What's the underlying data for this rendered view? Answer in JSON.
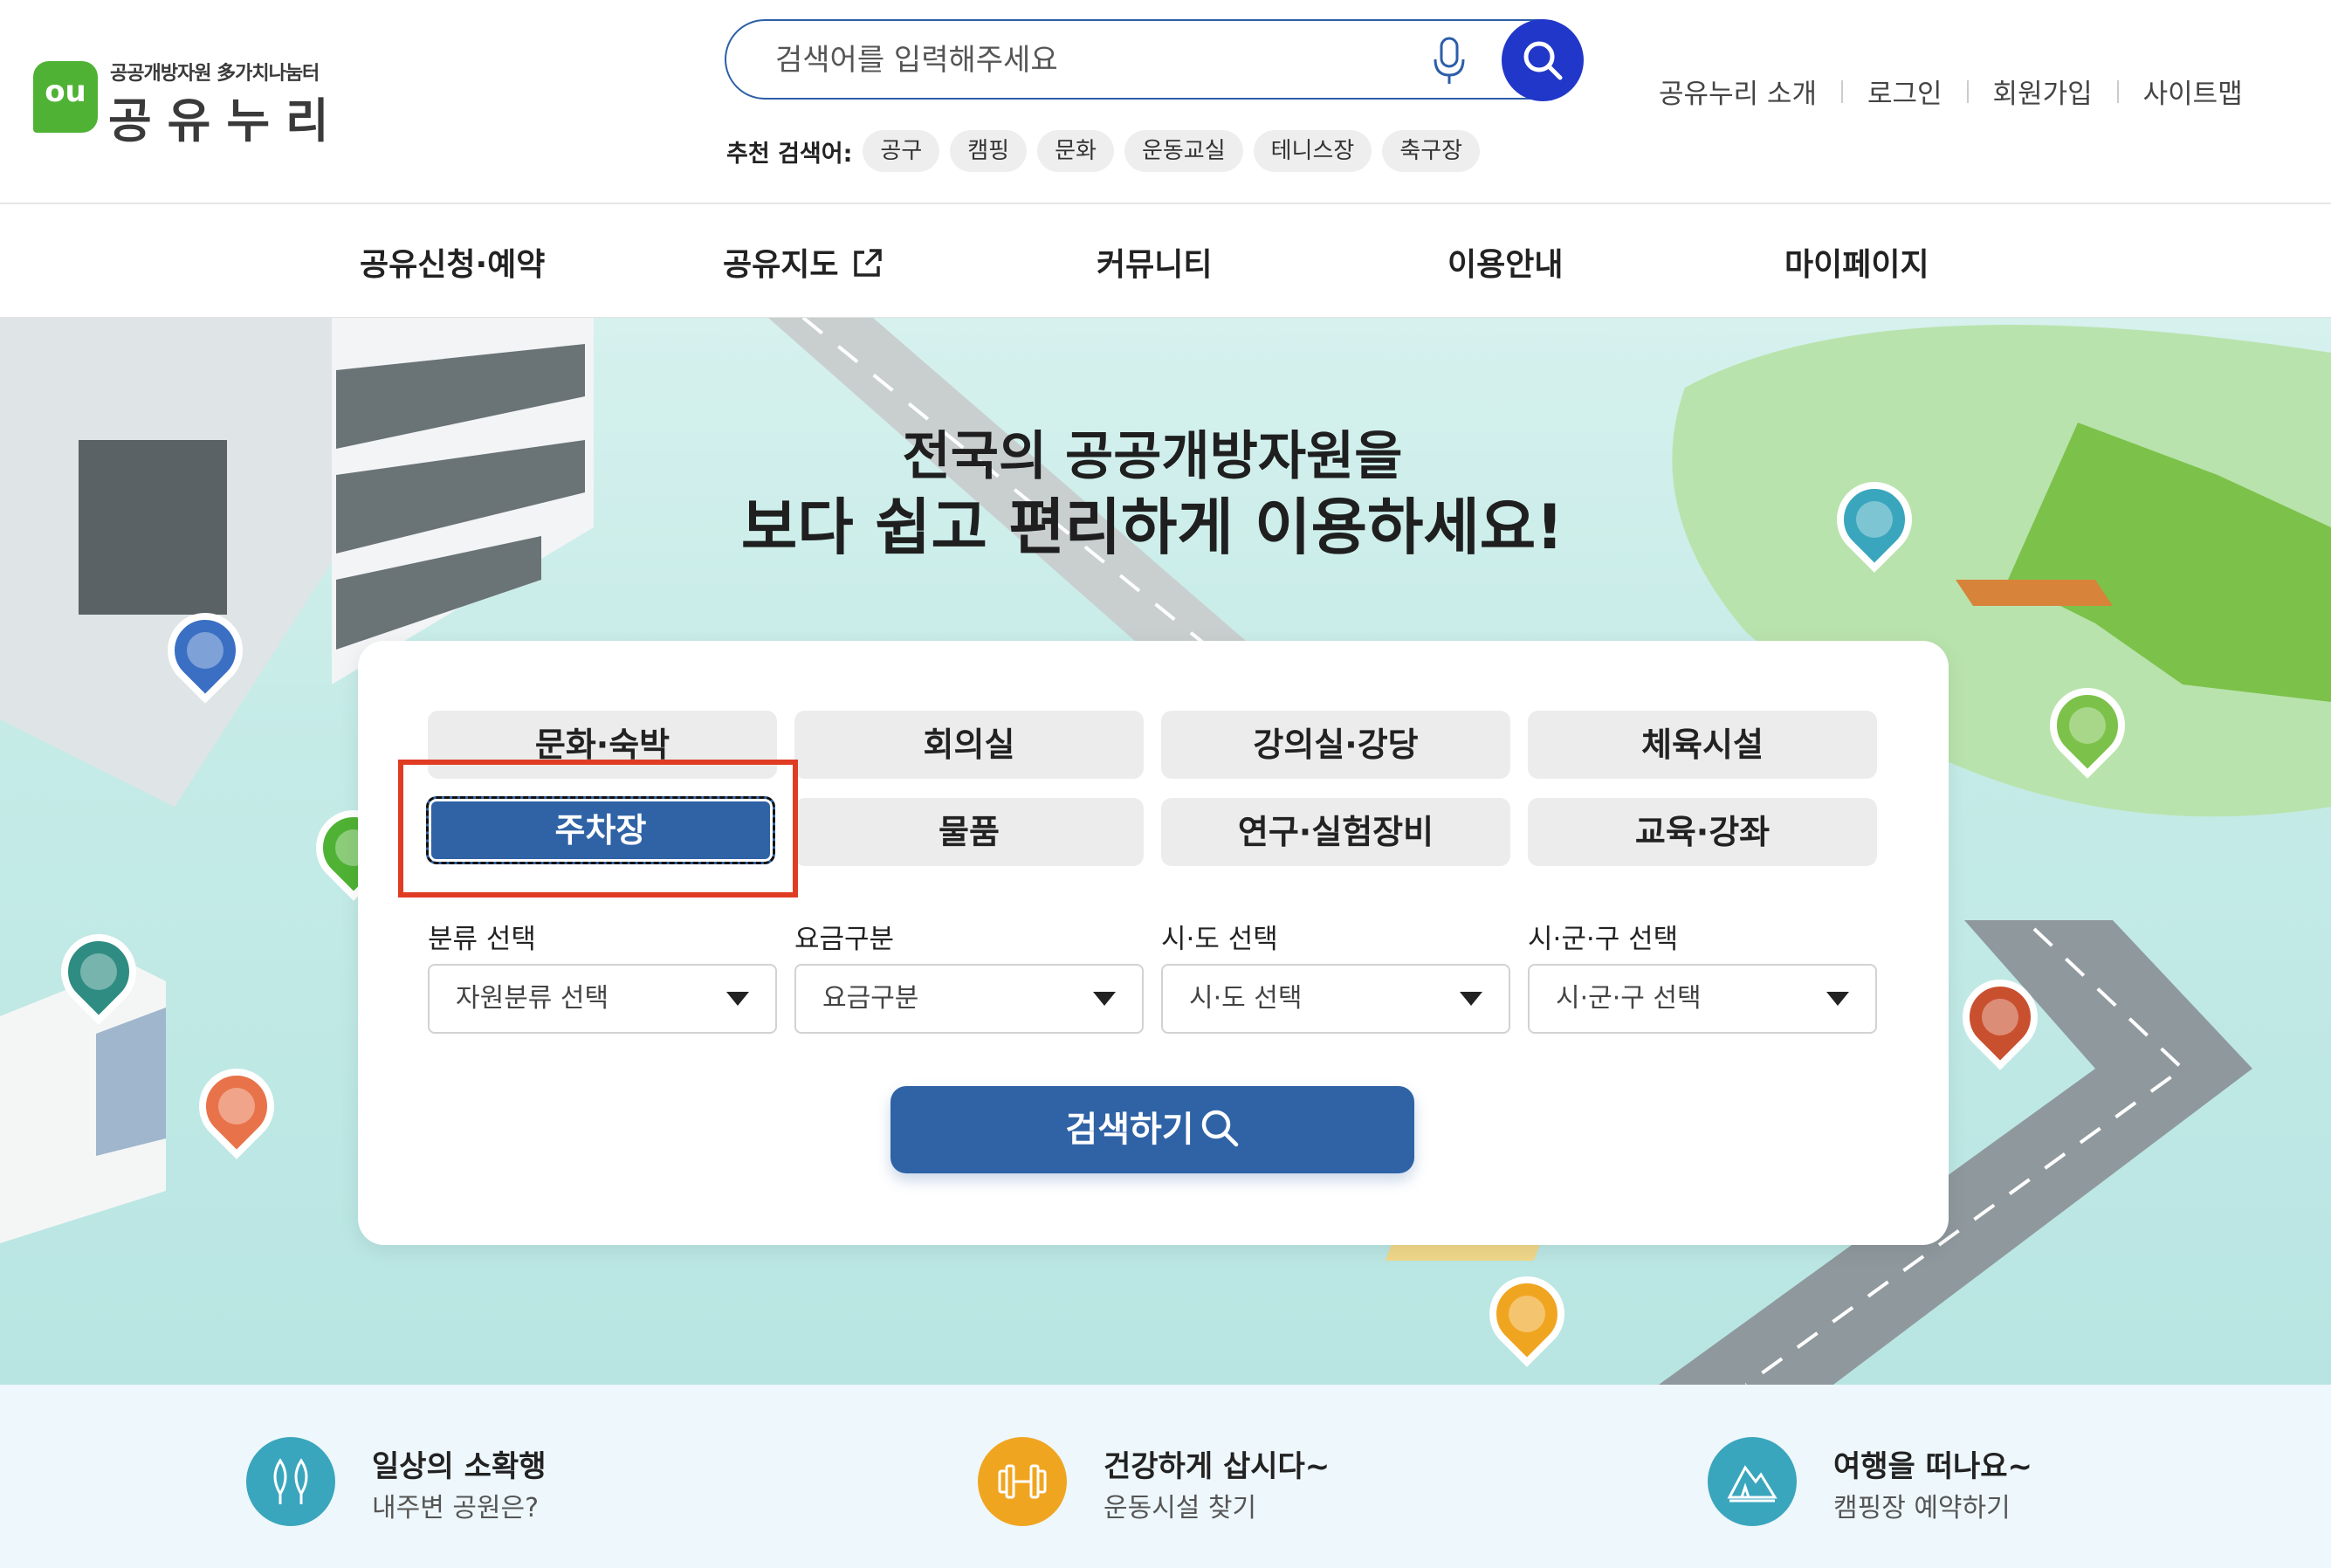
{
  "header": {
    "logo": {
      "badge": "ou",
      "subtitle": "공공개방자원 多가치나눔터",
      "name": "공유누리"
    },
    "search": {
      "placeholder": "검색어를 입력해주세요"
    },
    "recommended": {
      "label": "추천 검색어:",
      "keywords": [
        "공구",
        "캠핑",
        "문화",
        "운동교실",
        "테니스장",
        "축구장"
      ]
    },
    "util_links": [
      "공유누리 소개",
      "로그인",
      "회원가입",
      "사이트맵"
    ]
  },
  "nav": {
    "items": [
      "공유신청·예약",
      "공유지도",
      "커뮤니티",
      "이용안내",
      "마이페이지"
    ]
  },
  "hero": {
    "title_line1": "전국의 공공개방자원을",
    "title_line2": "보다 쉽고 편리하게 이용하세요!"
  },
  "search_card": {
    "categories": [
      "문화·숙박",
      "회의실",
      "강의실·강당",
      "체육시설",
      "주차장",
      "물품",
      "연구·실험장비",
      "교육·강좌"
    ],
    "selected_category": "주차장",
    "filters": [
      {
        "label": "분류 선택",
        "value": "자원분류 선택"
      },
      {
        "label": "요금구분",
        "value": "요금구분"
      },
      {
        "label": "시·도 선택",
        "value": "시·도 선택"
      },
      {
        "label": "시·군·구 선택",
        "value": "시·군·구 선택"
      }
    ],
    "submit_label": "검색하기"
  },
  "features": [
    {
      "title": "일상의 소확행",
      "subtitle": "내주변 공원은?",
      "icon": "park-icon",
      "color": "#3aa6bd"
    },
    {
      "title": "건강하게 삽시다~",
      "subtitle": "운동시설 찾기",
      "icon": "dumbbell-icon",
      "color": "#f0a521"
    },
    {
      "title": "여행을 떠나요~",
      "subtitle": "캠핑장 예약하기",
      "icon": "tent-icon",
      "color": "#3aa6bd"
    }
  ],
  "colors": {
    "primary": "#2f63a6",
    "search_button": "#2137c9",
    "logo_green": "#4fb234",
    "highlight": "#e03c24"
  }
}
